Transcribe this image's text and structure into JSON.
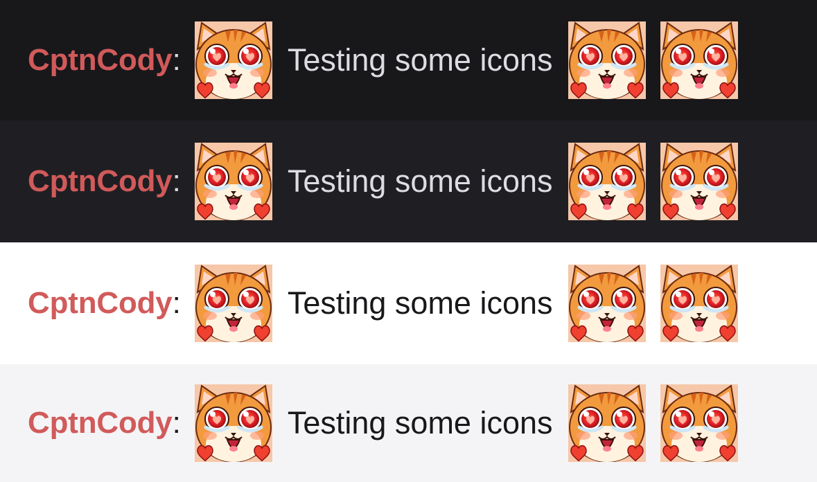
{
  "theme_colors": {
    "username": "#d15a5a",
    "row_backgrounds": [
      "#18181b",
      "#1f1f23",
      "#ffffff",
      "#f4f4f6"
    ],
    "text_dark_theme": "#dcdce2",
    "text_light_theme": "#18181b"
  },
  "emote": {
    "name": "heart-eyes-cat-emote",
    "colors": {
      "fur": "#f29a3e",
      "stripe": "#d8621c",
      "face": "#fff3df",
      "eye": "#e11e25",
      "heart": "#f0402f",
      "tear": "#cfe6f5"
    }
  },
  "messages": [
    {
      "username": "CptnCody",
      "separator": ":",
      "text": "Testing some icons"
    },
    {
      "username": "CptnCody",
      "separator": ":",
      "text": "Testing some icons"
    },
    {
      "username": "CptnCody",
      "separator": ":",
      "text": "Testing some icons"
    },
    {
      "username": "CptnCody",
      "separator": ":",
      "text": "Testing some icons"
    }
  ]
}
